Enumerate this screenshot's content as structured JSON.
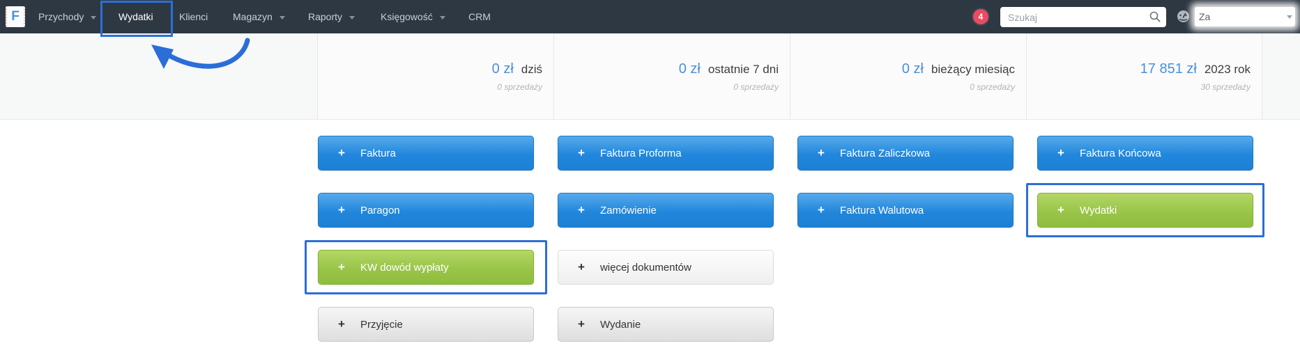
{
  "nav": {
    "logo_letter": "F",
    "items": [
      {
        "label": "Przychody",
        "has_dropdown": true
      },
      {
        "label": "Wydatki",
        "has_dropdown": false
      },
      {
        "label": "Klienci",
        "has_dropdown": false
      },
      {
        "label": "Magazyn",
        "has_dropdown": true
      },
      {
        "label": "Raporty",
        "has_dropdown": true
      },
      {
        "label": "Księgowość",
        "has_dropdown": true
      },
      {
        "label": "CRM",
        "has_dropdown": false
      }
    ],
    "notification_badge": "4",
    "search": {
      "placeholder": "Szukaj"
    },
    "user_label_visible": "Za"
  },
  "stats": [
    {
      "value": "0 zł",
      "label": "dziś",
      "sub": "0 sprzedaży"
    },
    {
      "value": "0 zł",
      "label": "ostatnie 7 dni",
      "sub": "0 sprzedaży"
    },
    {
      "value": "0 zł",
      "label": "bieżący miesiąc",
      "sub": "0 sprzedaży"
    },
    {
      "value": "17 851 zł",
      "label": "2023 rok",
      "sub": "30 sprzedaży"
    }
  ],
  "action_buttons": [
    {
      "label": "Faktura",
      "variant": "blue"
    },
    {
      "label": "Faktura Proforma",
      "variant": "blue"
    },
    {
      "label": "Faktura Zaliczkowa",
      "variant": "blue"
    },
    {
      "label": "Faktura Końcowa",
      "variant": "blue"
    },
    {
      "label": "Paragon",
      "variant": "blue"
    },
    {
      "label": "Zamówienie",
      "variant": "blue"
    },
    {
      "label": "Faktura Walutowa",
      "variant": "blue"
    },
    {
      "label": "Wydatki",
      "variant": "green",
      "annotated": true
    },
    {
      "label": "KW dowód wypłaty",
      "variant": "green",
      "annotated": true
    },
    {
      "label": "więcej dokumentów",
      "variant": "light"
    },
    {
      "label": "Przyjęcie",
      "variant": "gray"
    },
    {
      "label": "Wydanie",
      "variant": "gray"
    }
  ],
  "annotations": {
    "highlighted_nav_item": "Wydatki",
    "highlight_color": "#2b6ed8"
  },
  "colors": {
    "navbar_bg": "#2e3842",
    "primary_button": "#2187dc",
    "success_button": "#8fbd3d",
    "stat_value_blue": "#4a90d9",
    "notification_badge": "#e74c63",
    "annotation_blue": "#2b6ed8"
  }
}
